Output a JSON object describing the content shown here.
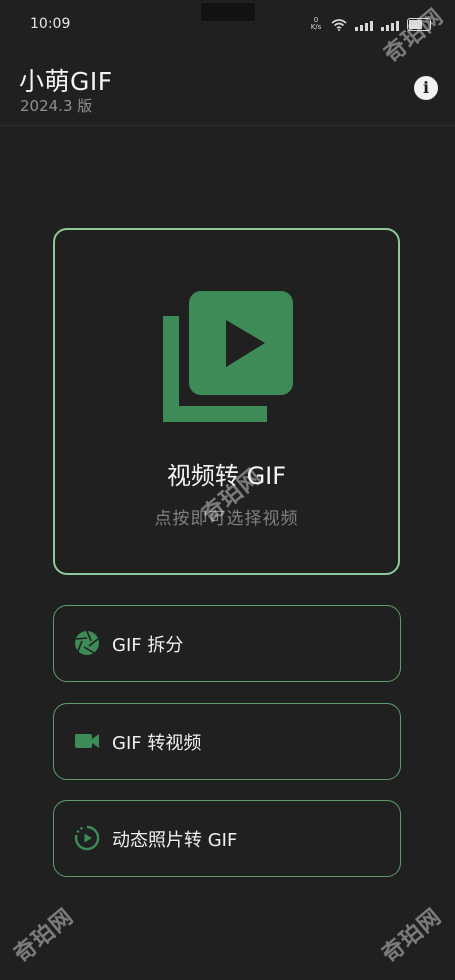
{
  "status_bar": {
    "time": "10:09",
    "speed": "0 K/s"
  },
  "app": {
    "title": "小萌GIF",
    "version": "2024.3 版"
  },
  "main": {
    "label": "视频转 GIF",
    "hint": "点按即可选择视频"
  },
  "options": [
    {
      "label": "GIF 拆分",
      "icon": "aperture-icon"
    },
    {
      "label": "GIF 转视频",
      "icon": "videocam-icon"
    },
    {
      "label": "动态照片转 GIF",
      "icon": "motion-photo-icon"
    }
  ],
  "watermark": "奇珀网",
  "colors": {
    "background": "#1f201f",
    "accent_green": "#3d8b57",
    "card_border": "#8ec79a"
  }
}
